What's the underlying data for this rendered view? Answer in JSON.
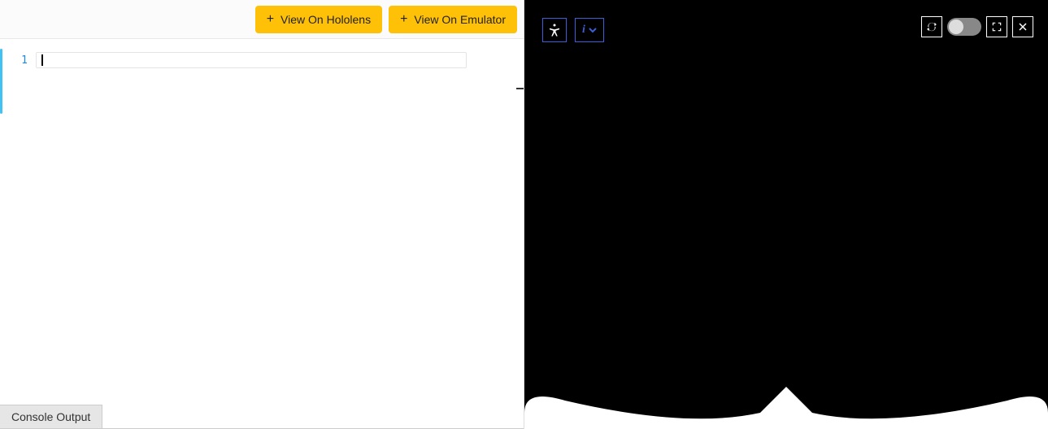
{
  "toolbar": {
    "hololens_label": "View On Hololens",
    "emulator_label": "View On Emulator"
  },
  "editor": {
    "line_number": "1",
    "content": ""
  },
  "console": {
    "tab_label": "Console Output"
  },
  "viewer": {
    "info_label": "i"
  }
}
